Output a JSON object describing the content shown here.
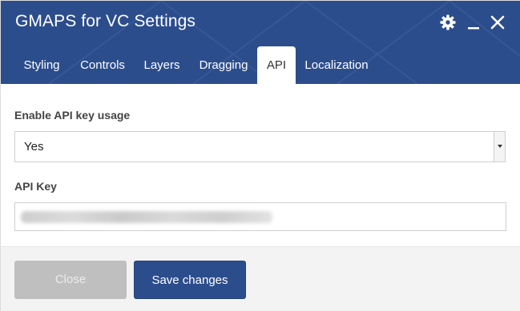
{
  "window": {
    "title": "GMAPS for VC Settings"
  },
  "header_controls": {
    "settings_icon": "gear-icon",
    "minimize_icon": "minimize-icon",
    "close_icon": "close-icon"
  },
  "tabs": [
    {
      "label": "Styling",
      "active": false
    },
    {
      "label": "Controls",
      "active": false
    },
    {
      "label": "Layers",
      "active": false
    },
    {
      "label": "Dragging",
      "active": false
    },
    {
      "label": "API",
      "active": true
    },
    {
      "label": "Localization",
      "active": false
    }
  ],
  "form": {
    "enable_api": {
      "label": "Enable API key usage",
      "value": "Yes"
    },
    "api_key": {
      "label": "API Key",
      "value_obscured": true
    }
  },
  "footer": {
    "close_label": "Close",
    "save_label": "Save changes"
  },
  "colors": {
    "header": "#2c4d8c",
    "primary_button": "#2c4d8c",
    "disabled_button": "#bfbfbf",
    "footer_bg": "#f3f3f3"
  }
}
